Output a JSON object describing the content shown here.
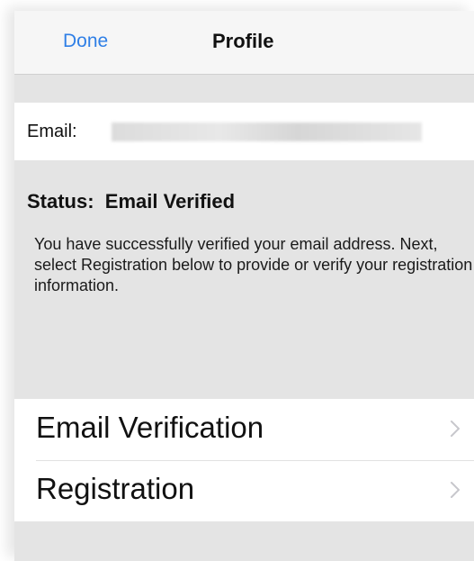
{
  "nav": {
    "done_label": "Done",
    "title": "Profile"
  },
  "email": {
    "label": "Email:",
    "value": ""
  },
  "status": {
    "label": "Status:",
    "value": "Email Verified",
    "description": "You have successfully verified your email address. Next, select Registration below to provide or verify your registration information."
  },
  "list": {
    "items": [
      {
        "label": "Email Verification",
        "icon": "chevron-right-icon"
      },
      {
        "label": "Registration",
        "icon": "chevron-right-icon"
      }
    ]
  },
  "colors": {
    "accent": "#2f7fe6",
    "background": "#e4e4e4",
    "nav_background": "#f6f6f6",
    "chevron": "#c7c7cc"
  }
}
